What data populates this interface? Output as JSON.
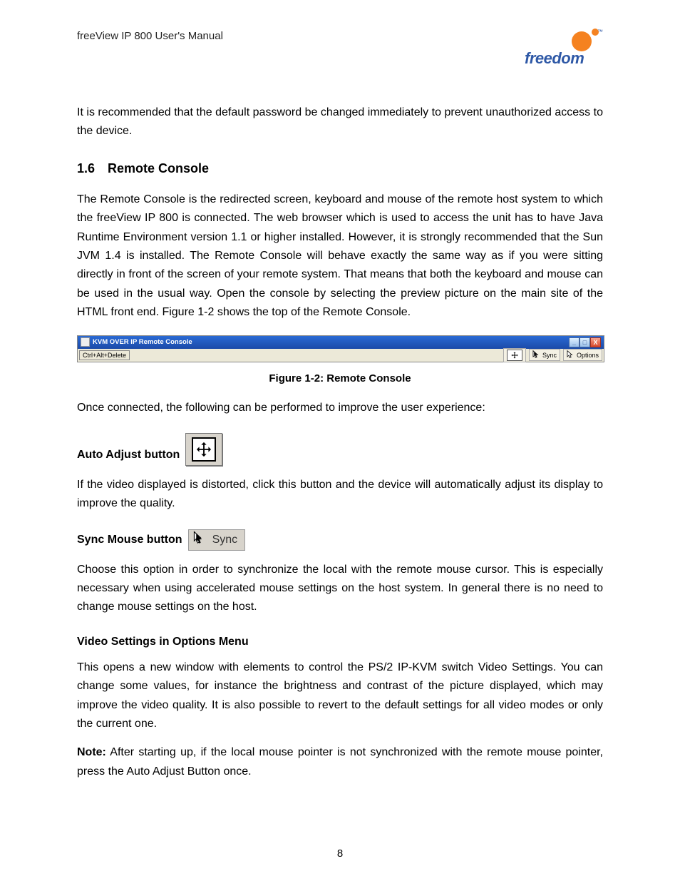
{
  "header": {
    "manual_title": "freeView IP 800 User's Manual",
    "logo_wordmark": "freedom",
    "logo_tm": "™"
  },
  "intro_paragraph": "It is recommended that the default password be changed immediately to prevent unauthorized access to the device.",
  "section": {
    "number": "1.6",
    "title": "Remote Console"
  },
  "section_p1": "The Remote Console is the redirected screen, keyboard and mouse of the remote host system to which the freeView IP 800 is connected. The web browser which is used to access the unit has to have Java Runtime Environment version 1.1 or higher installed. However, it is strongly recommended that the Sun JVM 1.4 is installed. The Remote Console will behave exactly the same way as if you were sitting directly in front of the screen of your remote system. That means that both the keyboard and mouse can be used in the usual way. Open the console by selecting the preview picture on the main site of the HTML front end. Figure 1-2 shows the top of the Remote Console.",
  "figure": {
    "window_title": "KVM OVER IP Remote Console",
    "toolbar_left_btn": "Ctrl+Alt+Delete",
    "toolbar_sync": "Sync",
    "toolbar_options": "Options",
    "caption": "Figure 1-2: Remote Console"
  },
  "post_figure_p": "Once connected, the following can be performed to improve the user experience:",
  "auto_adjust": {
    "label": "Auto Adjust button",
    "paragraph": "If the video displayed is distorted, click this button and the device will automatically adjust its display to improve the quality."
  },
  "sync_mouse": {
    "label": "Sync Mouse button",
    "graphic_text": "Sync",
    "paragraph": "Choose this option in order to synchronize the local with the remote mouse cursor. This is especially necessary when using accelerated mouse settings on the host system. In general there is no need to change mouse settings on the host."
  },
  "video_settings": {
    "heading": "Video Settings in Options Menu",
    "paragraph": "This opens a new window with elements to control the PS/2 IP-KVM switch Video Settings. You can change some values, for instance the brightness and contrast of the picture displayed, which may improve the video quality. It is also possible to revert to the default settings for all video modes or only the current one."
  },
  "note": {
    "label": "Note:",
    "text": " After starting up, if the local mouse pointer is not synchronized with the remote mouse pointer, press the Auto Adjust Button once."
  },
  "page_number": "8"
}
